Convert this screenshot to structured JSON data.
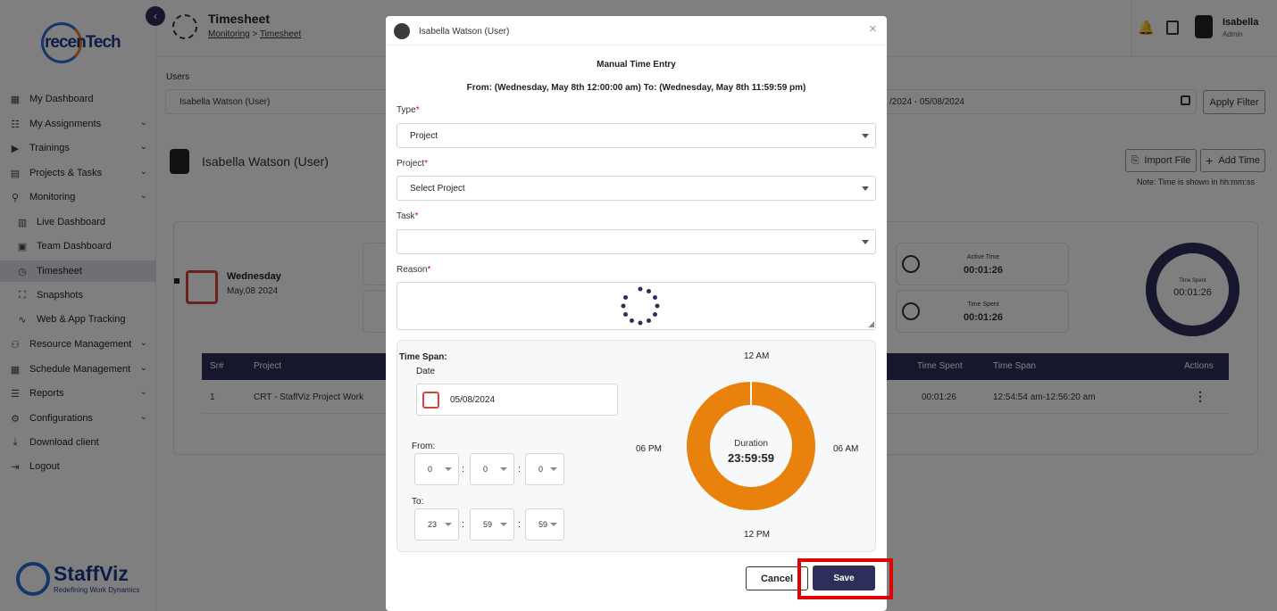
{
  "app": {
    "brand": "recenTech",
    "footer_brand": "StaffViz",
    "footer_tagline": "Redefining Work Dynamics",
    "page_title": "Timesheet",
    "breadcrumb": [
      "Monitoring",
      "Timesheet"
    ],
    "breadcrumb_sep": ">",
    "user_name": "Isabella",
    "user_role": "Admin"
  },
  "sidebar": {
    "items": [
      {
        "label": "My Dashboard",
        "icon": "dashboard-icon"
      },
      {
        "label": "My Assignments",
        "icon": "assignments-icon"
      },
      {
        "label": "Trainings",
        "icon": "trainings-icon"
      },
      {
        "label": "Projects & Tasks",
        "icon": "projects-icon"
      },
      {
        "label": "Monitoring",
        "icon": "monitoring-icon"
      },
      {
        "label": "Live Dashboard",
        "icon": "bar-chart-icon"
      },
      {
        "label": "Team Dashboard",
        "icon": "team-icon"
      },
      {
        "label": "Timesheet",
        "icon": "timesheet-icon"
      },
      {
        "label": "Snapshots",
        "icon": "snapshot-icon"
      },
      {
        "label": "Web & App Tracking",
        "icon": "tracking-icon"
      },
      {
        "label": "Resource Management",
        "icon": "resource-icon"
      },
      {
        "label": "Schedule Management",
        "icon": "schedule-icon"
      },
      {
        "label": "Reports",
        "icon": "reports-icon"
      },
      {
        "label": "Configurations",
        "icon": "gear-icon"
      },
      {
        "label": "Download client",
        "icon": "download-icon"
      },
      {
        "label": "Logout",
        "icon": "logout-icon"
      }
    ]
  },
  "filters": {
    "users_label": "Users",
    "users_value": "Isabella Watson (User)",
    "date_range": "/2024 - 05/08/2024",
    "apply_label": "Apply Filter"
  },
  "profile": {
    "name": "Isabella Watson (User)",
    "import_label": "Import File",
    "add_time_label": "Add Time",
    "note": "Note: Time is shown in hh:mm:ss"
  },
  "summary": {
    "day": "Wednesday",
    "date": "May,08 2024",
    "active_time_label": "Active Time",
    "active_time": "00:01:26",
    "time_spent_label": "Time Spent",
    "time_spent": "00:01:26",
    "ring_label": "Time Spent",
    "ring_value": "00:01:26"
  },
  "table": {
    "headers": [
      "Sr#",
      "Project",
      "Time Spent",
      "Time Span",
      "Actions"
    ],
    "rows": [
      {
        "sr": "1",
        "project": "CRT - StaffViz Project Work",
        "time_spent": "00:01:26",
        "time_span": "12:54:54 am-12:56:20 am"
      }
    ]
  },
  "modal": {
    "header_name": "Isabella Watson (User)",
    "title": "Manual Time Entry",
    "range": "From: (Wednesday, May 8th 12:00:00 am) To: (Wednesday, May 8th 11:59:59 pm)",
    "type_label": "Type",
    "type_value": "Project",
    "project_label": "Project",
    "project_value": "Select Project",
    "task_label": "Task",
    "task_value": "",
    "reason_label": "Reason",
    "required_mark": "*",
    "timespan_label": "Time Span:",
    "date_label": "Date",
    "date_value": "05/08/2024",
    "from_label": "From:",
    "from": [
      "0",
      "0",
      "0"
    ],
    "to_label": "To:",
    "to": [
      "23",
      "59",
      "59"
    ],
    "colon": ":",
    "clock_top": "12 AM",
    "clock_right": "06 AM",
    "clock_bottom": "12 PM",
    "clock_left": "06 PM",
    "duration_label": "Duration",
    "duration_value": "23:59:59",
    "duration_fraction": 1.0,
    "cancel_label": "Cancel",
    "save_label": "Save"
  },
  "colors": {
    "accent": "#2c2f5a",
    "donut": "#e8820c",
    "highlight": "#e00000"
  }
}
